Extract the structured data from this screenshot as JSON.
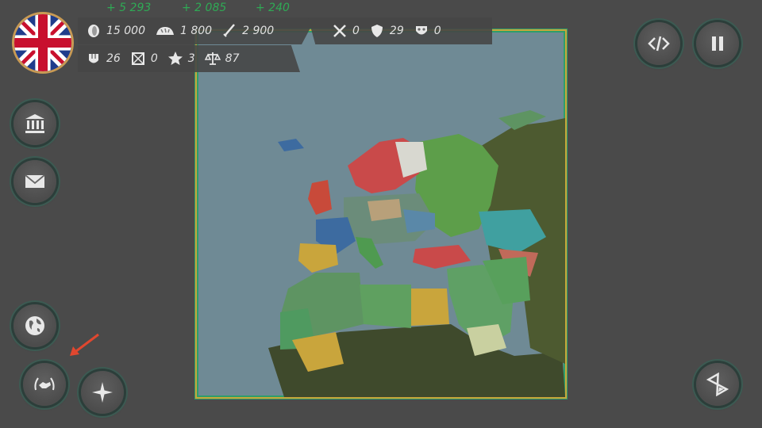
{
  "hud": {
    "gains": {
      "gold": "+ 5 293",
      "food": "+ 2 085",
      "manpower": "+ 240"
    },
    "gold": "15 000",
    "food": "1 800",
    "manpower": "2 900",
    "defense": "26",
    "broken_swords": "0",
    "stars": "3",
    "justice": "87",
    "crossed_swords": "0",
    "shields": "29",
    "masks": "0"
  },
  "flag": {
    "country": "United Kingdom"
  },
  "icons": {
    "gold": "coin-icon",
    "food": "bread-icon",
    "manpower": "sword-icon",
    "defense": "helmet-icon",
    "broken": "broken-shield-icon",
    "stars": "star-icon",
    "justice": "scales-icon",
    "crossed": "crossed-swords-icon",
    "shields": "shield-icon",
    "masks": "mask-icon"
  },
  "colors": {
    "gain_green": "#2faa55",
    "frame_gold": "#c7a63a",
    "frame_green": "#2e9e6a",
    "sea": "#6f8a95"
  }
}
